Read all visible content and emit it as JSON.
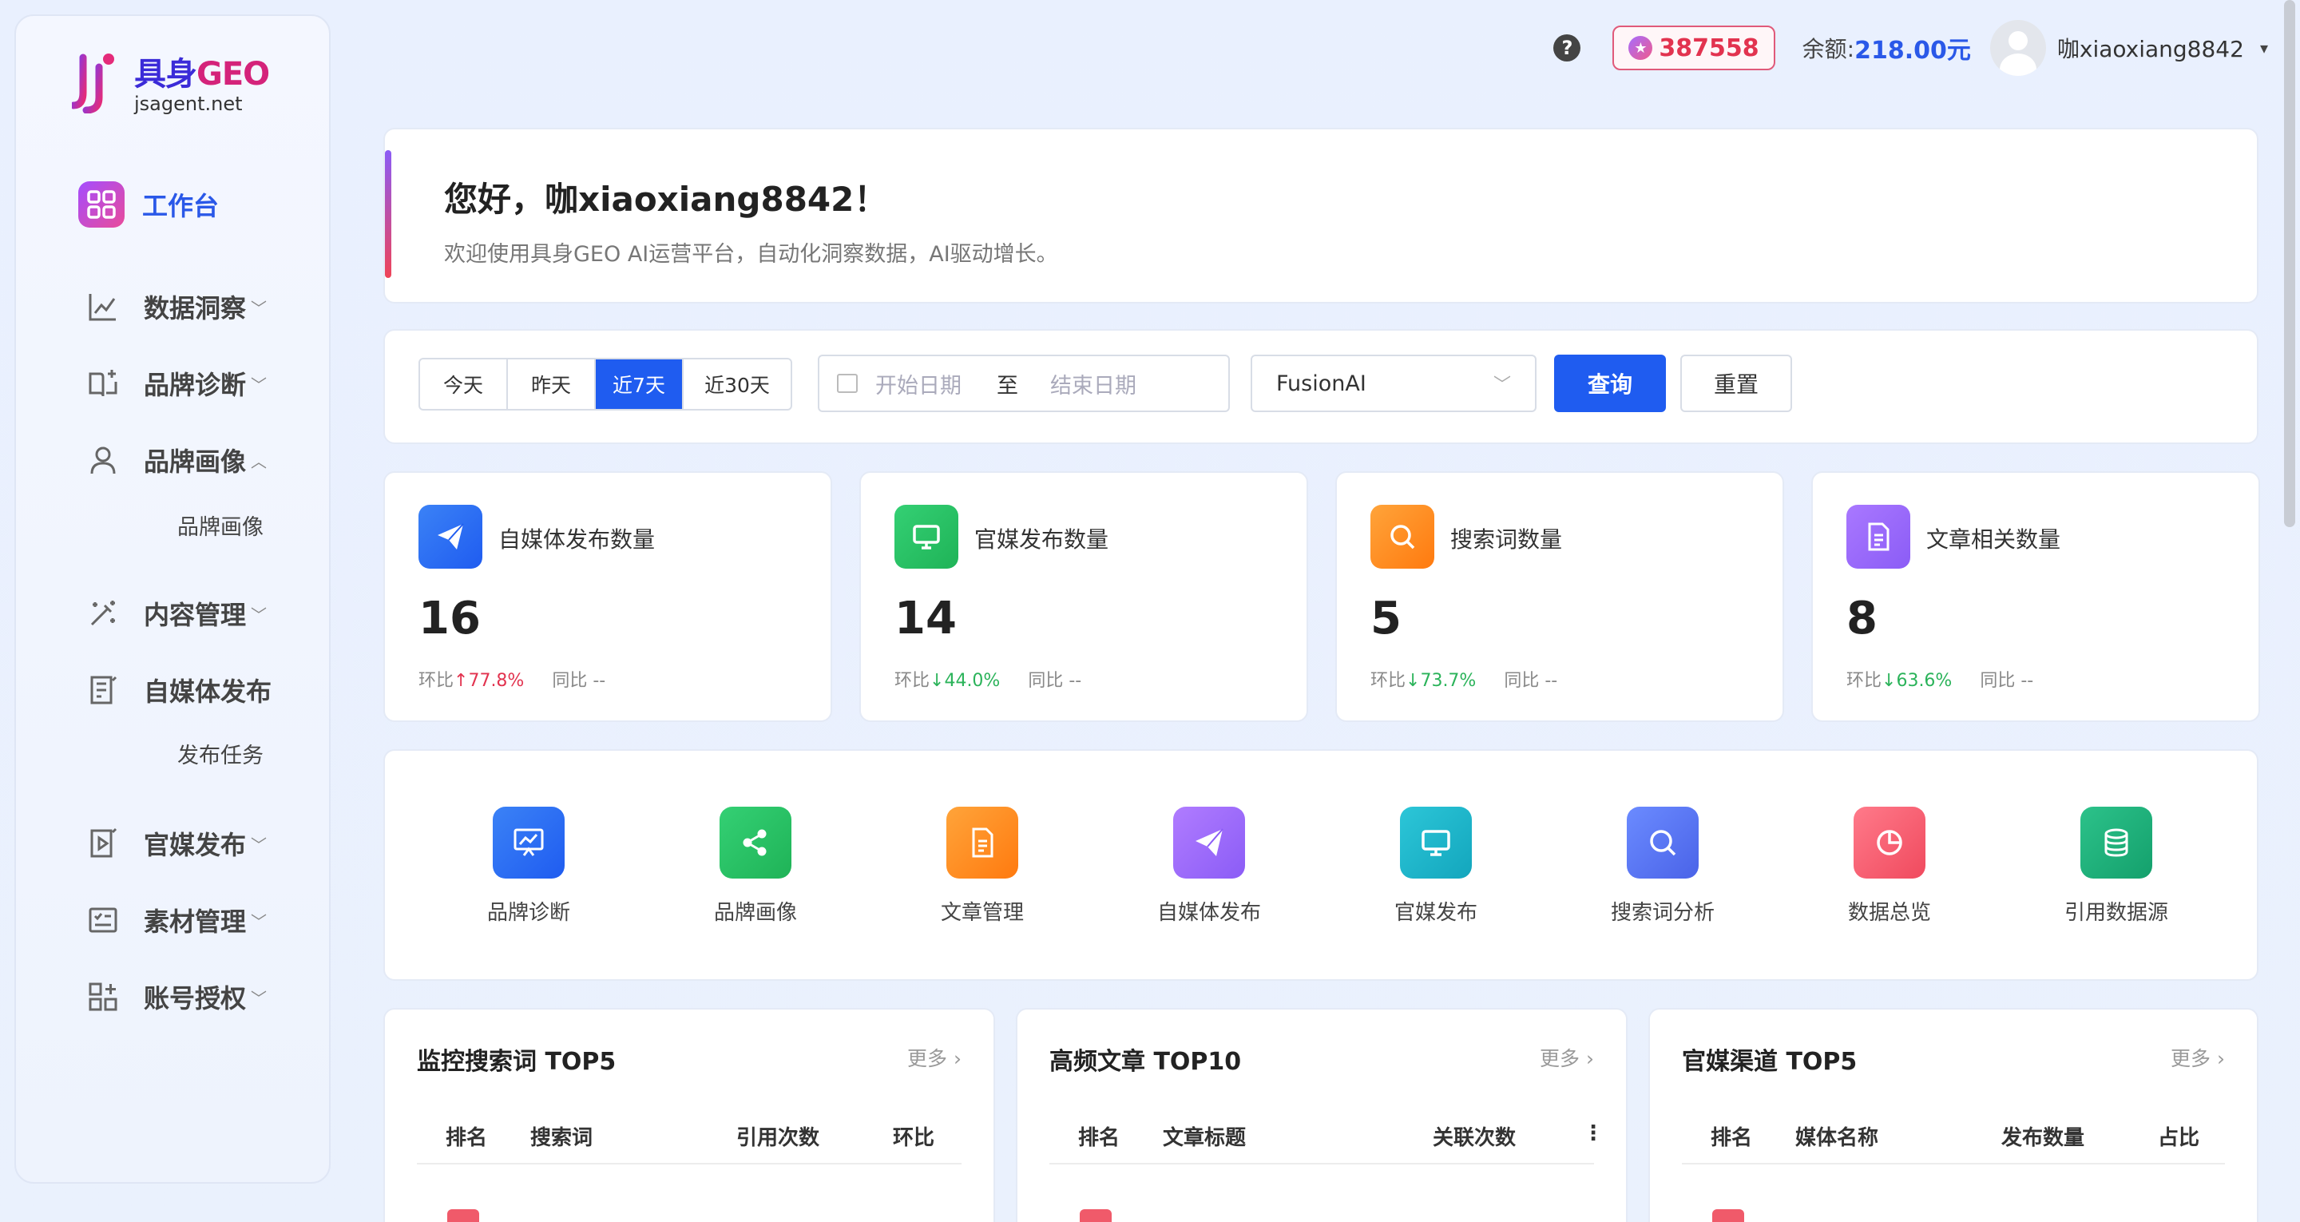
{
  "brand": {
    "name_cn": "具身",
    "name_en": "GEO",
    "domain": "jsagent.net"
  },
  "header": {
    "help": "?",
    "points": "387558",
    "balance_label": "余额:",
    "balance_value": "218.00元",
    "username": "咖xiaoxiang8842",
    "caret": "▾"
  },
  "sidebar": {
    "items": [
      {
        "label": "工作台"
      },
      {
        "label": "数据洞察"
      },
      {
        "label": "品牌诊断"
      },
      {
        "label": "品牌画像"
      },
      {
        "label": "内容管理"
      },
      {
        "label": "自媒体发布"
      },
      {
        "label": "官媒发布"
      },
      {
        "label": "素材管理"
      },
      {
        "label": "账号授权"
      }
    ],
    "sub_brand_profile": "品牌画像",
    "sub_publish_task": "发布任务"
  },
  "welcome": {
    "title": "您好，咖xiaoxiang8842！",
    "subtitle": "欢迎使用具身GEO AI运营平台，自动化洞察数据，AI驱动增长。"
  },
  "filter": {
    "ranges": [
      "今天",
      "昨天",
      "近7天",
      "近30天"
    ],
    "start_placeholder": "开始日期",
    "separator": "至",
    "end_placeholder": "结束日期",
    "model": "FusionAI",
    "query": "查询",
    "reset": "重置"
  },
  "stats": [
    {
      "label": "自媒体发布数量",
      "value": "16",
      "mom_label": "环比",
      "mom": "↑77.8%",
      "yoy_label": "同比",
      "yoy": "--",
      "color": "#1f6cf5"
    },
    {
      "label": "官媒发布数量",
      "value": "14",
      "mom_label": "环比",
      "mom": "↓44.0%",
      "yoy_label": "同比",
      "yoy": "--",
      "color": "#22c35e"
    },
    {
      "label": "搜索词数量",
      "value": "5",
      "mom_label": "环比",
      "mom": "↓73.7%",
      "yoy_label": "同比",
      "yoy": "--",
      "color": "#ff8a1a"
    },
    {
      "label": "文章相关数量",
      "value": "8",
      "mom_label": "环比",
      "mom": "↓63.6%",
      "yoy_label": "同比",
      "yoy": "--",
      "color": "#9b5cf6"
    }
  ],
  "quick": [
    {
      "label": "品牌诊断"
    },
    {
      "label": "品牌画像"
    },
    {
      "label": "文章管理"
    },
    {
      "label": "自媒体发布"
    },
    {
      "label": "官媒发布"
    },
    {
      "label": "搜索词分析"
    },
    {
      "label": "数据总览"
    },
    {
      "label": "引用数据源"
    }
  ],
  "tables": [
    {
      "title": "监控搜索词 TOP5",
      "more": "更多 ›",
      "cols": [
        "排名",
        "搜索词",
        "引用次数",
        "环比"
      ]
    },
    {
      "title": "高频文章 TOP10",
      "more": "更多 ›",
      "cols": [
        "排名",
        "文章标题",
        "关联次数",
        "⋮"
      ]
    },
    {
      "title": "官媒渠道 TOP5",
      "more": "更多 ›",
      "cols": [
        "排名",
        "媒体名称",
        "发布数量",
        "占比"
      ]
    }
  ]
}
